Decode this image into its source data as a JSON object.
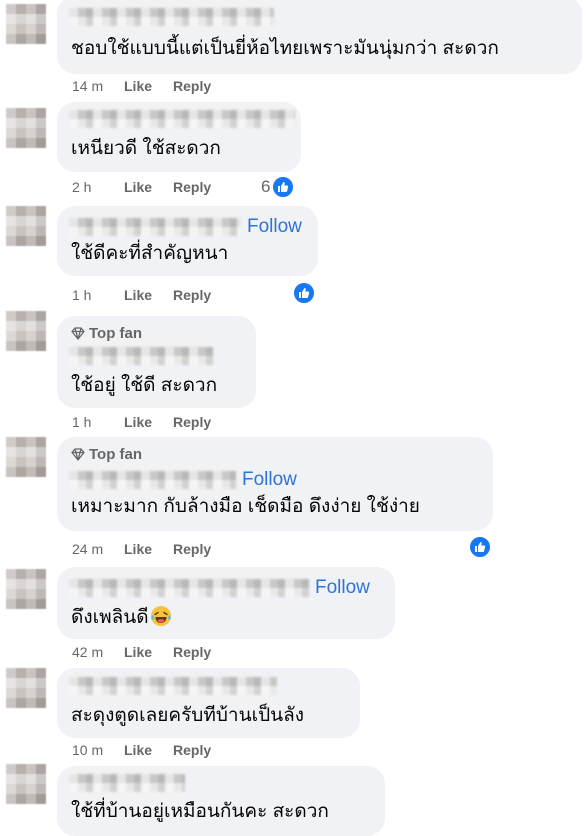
{
  "colors": {
    "bubble": "#f0f2f5",
    "link": "#2e74d6",
    "meta": "#65676b",
    "like_badge": "#1877f2"
  },
  "comments": [
    {
      "text": "ชอบใช้แบบนี้แต่เป็นยี่ห้อไทยเพราะมันนุ่มกว่า สะดวก",
      "time": "14 m",
      "like": "Like",
      "reply": "Reply"
    },
    {
      "text": "เหนียวดี ใช้สะดวก",
      "time": "2 h",
      "like": "Like",
      "reply": "Reply",
      "reaction_count": "6"
    },
    {
      "follow": "Follow",
      "text": "ใช้ดีคะที่สำคัญหนา",
      "time": "1 h",
      "like": "Like",
      "reply": "Reply"
    },
    {
      "badge": "Top fan",
      "text": "ใช้อยู่ ใช้ดี สะดวก",
      "time": "1 h",
      "like": "Like",
      "reply": "Reply"
    },
    {
      "badge": "Top fan",
      "follow": "Follow",
      "text": "เหมาะมาก กับล้างมือ เช็ดมือ ดึงง่าย ใช้ง่าย",
      "time": "24 m",
      "like": "Like",
      "reply": "Reply"
    },
    {
      "follow": "Follow",
      "text": "ดึงเพลินดี",
      "emoji": "grinning-tears-emoji",
      "time": "42 m",
      "like": "Like",
      "reply": "Reply"
    },
    {
      "text": "สะดุงตูดเลยครับทีบ้านเป็นลัง",
      "time": "10 m",
      "like": "Like",
      "reply": "Reply"
    },
    {
      "text": "ใช้ที่บ้านอยู่เหมือนกันคะ สะดวก"
    }
  ]
}
